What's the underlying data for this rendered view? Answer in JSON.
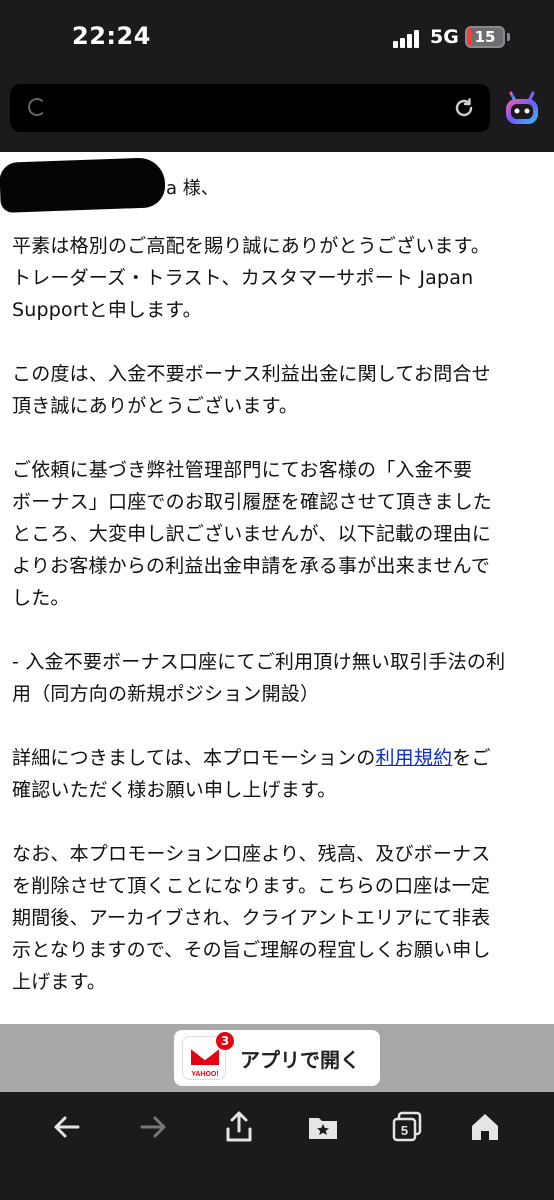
{
  "status_bar": {
    "time": "22:24",
    "network": "5G",
    "battery": "15",
    "battery_level_percent": 15
  },
  "browser": {
    "url_bar": {
      "icons": [
        "loading-spinner-icon",
        "reload-icon"
      ]
    },
    "assistant_icon": "robot-icon"
  },
  "email": {
    "salutation": "a 様、",
    "paragraphs": [
      {
        "lines": [
          "平素は格別のご高配を賜り誠にありがとうございます。",
          "トレーダーズ・トラスト、カスタマーサポート Japan",
          "Supportと申します。"
        ]
      },
      {
        "lines": [
          "この度は、入金不要ボーナス利益出金に関してお問合せ",
          "頂き誠にありがとうございます。"
        ]
      },
      {
        "lines": [
          "ご依頼に基づき弊社管理部門にてお客様の「入金不要",
          "ボーナス」口座でのお取引履歴を確認させて頂きました",
          "ところ、大変申し訳ございませんが、以下記載の理由に",
          "よりお客様からの利益出金申請を承る事が出来ませんで",
          "した。"
        ]
      },
      {
        "lines": [
          "- 入金不要ボーナス口座にてご利用頂け無い取引手法の利",
          "用（同方向の新規ポジション開設）"
        ]
      },
      {
        "line1_before": "詳細につきましては、本プロモーションの",
        "link_text": "利用規約",
        "line1_after": "をご",
        "line2": "確認いただく様お願い申し上げます。"
      },
      {
        "lines": [
          "なお、本プロモーション口座より、残高、及びボーナス",
          "を削除させて頂くことになります。こちらの口座は一定",
          "期間後、アーカイブされ、クライアントエリアにて非表",
          "示となりますので、その旨ご理解の程宜しくお願い申し",
          "上げます。"
        ]
      }
    ]
  },
  "app_banner": {
    "button_label": "アプリで開く",
    "mail_icon_badge": "3",
    "mail_icon_brand": "YAHOO!"
  },
  "toolbar": {
    "icons": [
      "back-arrow-icon",
      "forward-arrow-icon",
      "share-icon",
      "bookmarks-folder-icon",
      "tabs-icon",
      "home-icon"
    ],
    "tab_count": "5"
  },
  "colors": {
    "chrome_bg": "#1b1b1d",
    "link": "#0b2bd1",
    "battery_red": "#ff3b30",
    "assistant_gradient": [
      "#ff5aa0",
      "#6f5cff",
      "#2fc3ff"
    ],
    "badge_red": "#e60012"
  }
}
